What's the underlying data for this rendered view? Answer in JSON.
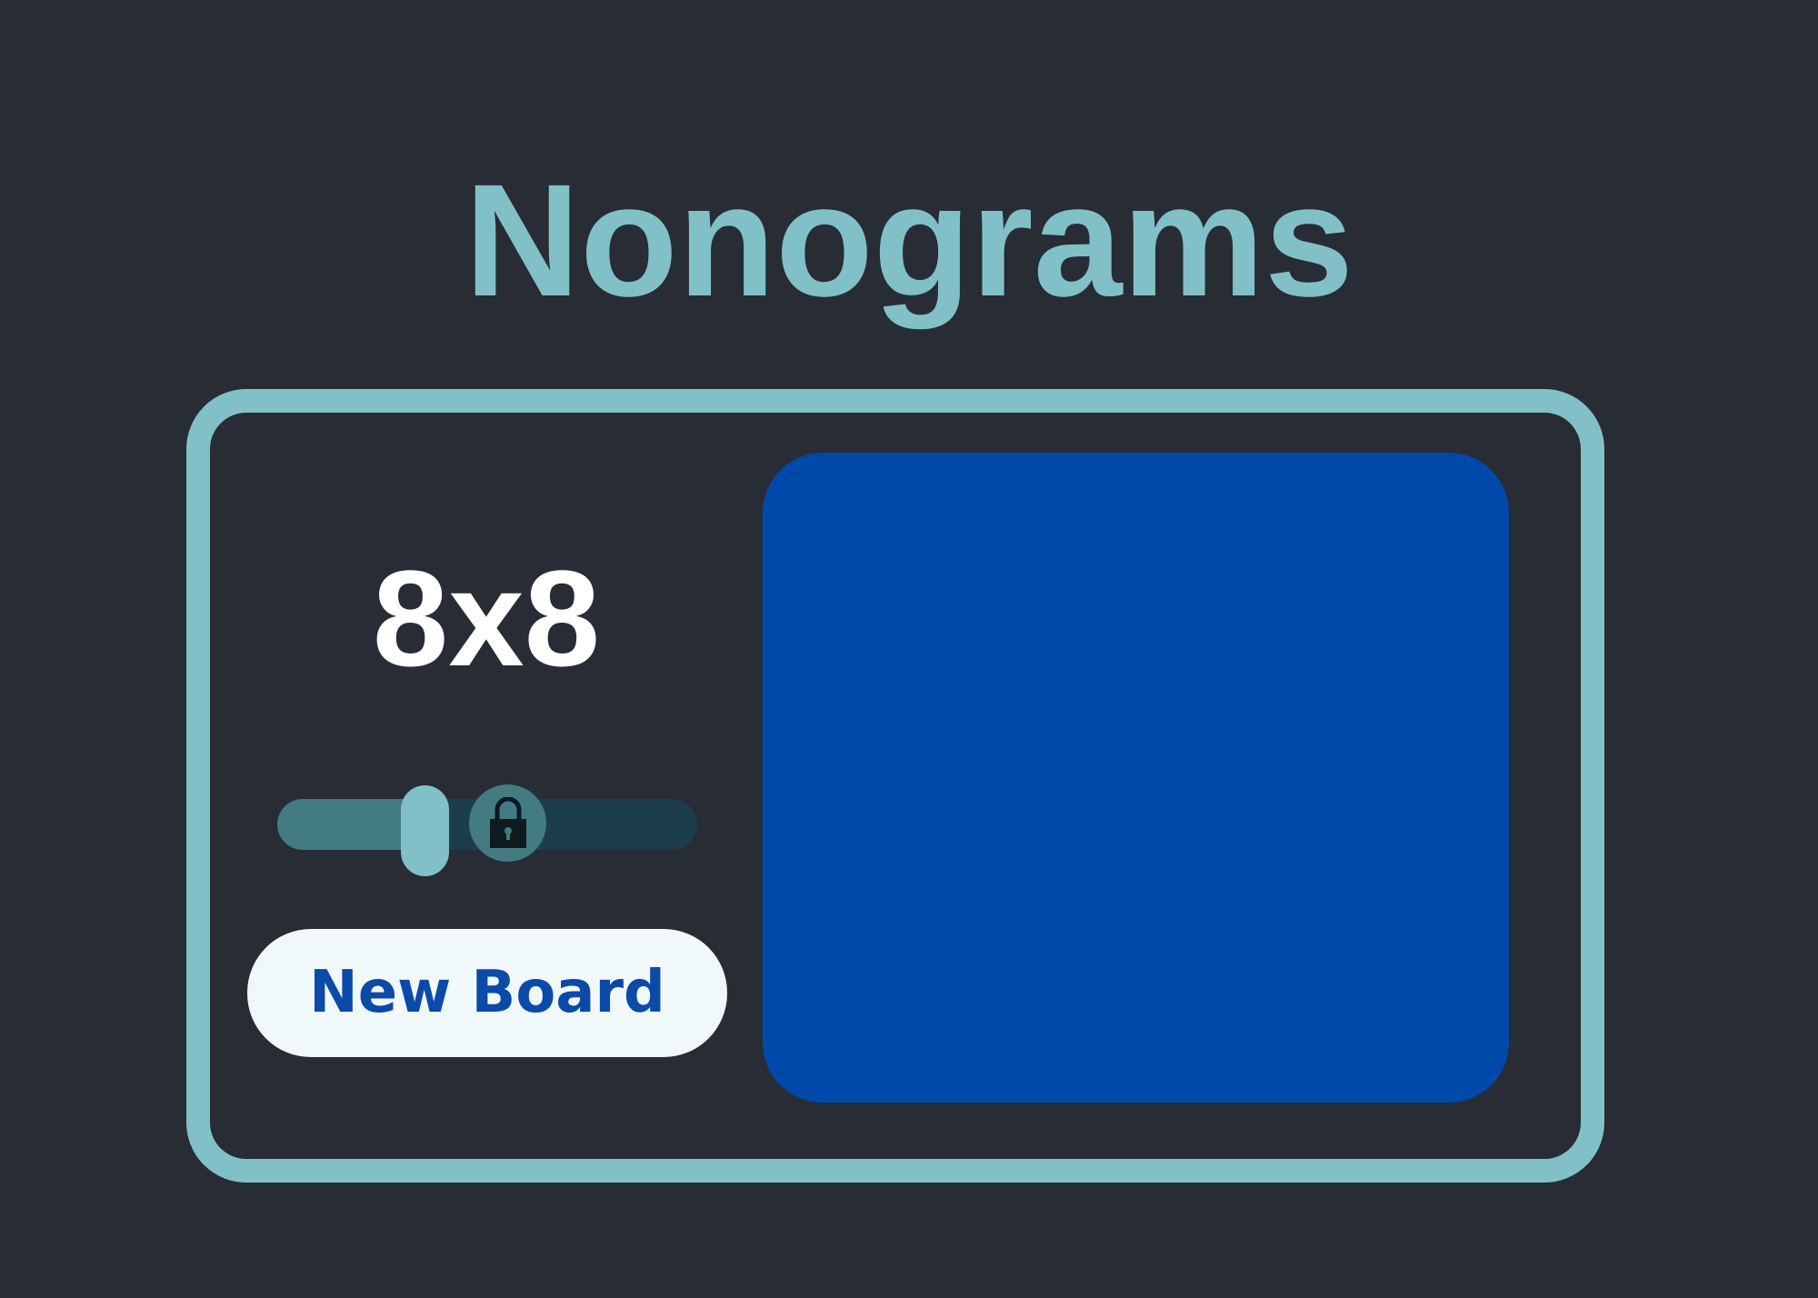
{
  "app": {
    "title": "Nonograms"
  },
  "controls": {
    "size_label": "8x8",
    "slider": {
      "value_fraction": 0.35,
      "locked": true
    },
    "new_board_label": "New Board"
  },
  "colors": {
    "background": "#282c34",
    "accent": "#82c0c8",
    "board": "#0049ab",
    "button_bg": "#f0f8fa",
    "button_text": "#0b4aa8"
  },
  "icons": {
    "lock": "lock-icon"
  }
}
